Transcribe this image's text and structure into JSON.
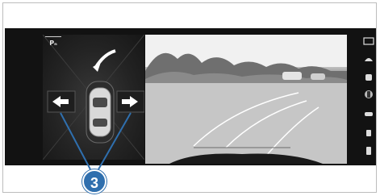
{
  "parking_indicator": {
    "label": "Pₙ",
    "icon": "parking-sensor-icon"
  },
  "callout": {
    "label": "3"
  },
  "colors": {
    "callout": "#2f6fae",
    "screen": "#121212",
    "accent": "#ffffff"
  },
  "right_strip": {
    "icons": [
      "camera-view-icon",
      "front-view-icon",
      "rear-view-icon",
      "top-view-icon",
      "side-view-icon",
      "trailer-view-icon",
      "exit-icon"
    ]
  }
}
